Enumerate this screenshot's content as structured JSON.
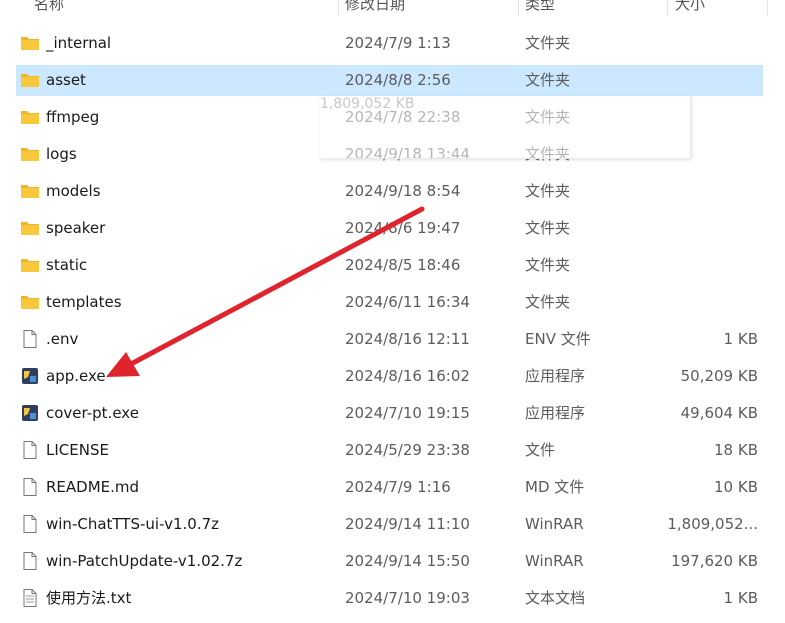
{
  "header": {
    "name": "名称",
    "date": "修改日期",
    "type": "类型",
    "size": "大小"
  },
  "ghost_tooltip": "1,809,052 KB",
  "files": [
    {
      "name": "_internal",
      "date": "2024/7/9 1:13",
      "type": "文件夹",
      "size": "",
      "icon": "folder-icon",
      "selected": false
    },
    {
      "name": "asset",
      "date": "2024/8/8 2:56",
      "type": "文件夹",
      "size": "",
      "icon": "folder-icon",
      "selected": true
    },
    {
      "name": "ffmpeg",
      "date": "2024/7/8 22:38",
      "type": "文件夹",
      "size": "",
      "icon": "folder-icon",
      "selected": false
    },
    {
      "name": "logs",
      "date": "2024/9/18 13:44",
      "type": "文件夹",
      "size": "",
      "icon": "folder-icon",
      "selected": false
    },
    {
      "name": "models",
      "date": "2024/9/18 8:54",
      "type": "文件夹",
      "size": "",
      "icon": "folder-icon",
      "selected": false
    },
    {
      "name": "speaker",
      "date": "2024/8/6 19:47",
      "type": "文件夹",
      "size": "",
      "icon": "folder-icon",
      "selected": false
    },
    {
      "name": "static",
      "date": "2024/8/5 18:46",
      "type": "文件夹",
      "size": "",
      "icon": "folder-icon",
      "selected": false
    },
    {
      "name": "templates",
      "date": "2024/6/11 16:34",
      "type": "文件夹",
      "size": "",
      "icon": "folder-icon",
      "selected": false
    },
    {
      "name": ".env",
      "date": "2024/8/16 12:11",
      "type": "ENV 文件",
      "size": "1 KB",
      "icon": "file-icon",
      "selected": false
    },
    {
      "name": "app.exe",
      "date": "2024/8/16 16:02",
      "type": "应用程序",
      "size": "50,209 KB",
      "icon": "exe-icon",
      "selected": false
    },
    {
      "name": "cover-pt.exe",
      "date": "2024/7/10 19:15",
      "type": "应用程序",
      "size": "49,604 KB",
      "icon": "exe-icon",
      "selected": false
    },
    {
      "name": "LICENSE",
      "date": "2024/5/29 23:38",
      "type": "文件",
      "size": "18 KB",
      "icon": "file-icon",
      "selected": false
    },
    {
      "name": "README.md",
      "date": "2024/7/9 1:16",
      "type": "MD 文件",
      "size": "10 KB",
      "icon": "file-icon",
      "selected": false
    },
    {
      "name": "win-ChatTTS-ui-v1.0.7z",
      "date": "2024/9/14 11:10",
      "type": "WinRAR",
      "size": "1,809,052...",
      "icon": "file-icon",
      "selected": false
    },
    {
      "name": "win-PatchUpdate-v1.02.7z",
      "date": "2024/9/14 15:50",
      "type": "WinRAR",
      "size": "197,620 KB",
      "icon": "file-icon",
      "selected": false
    },
    {
      "name": "使用方法.txt",
      "date": "2024/7/10 19:03",
      "type": "文本文档",
      "size": "1 KB",
      "icon": "text-file-icon",
      "selected": false
    }
  ],
  "colors": {
    "selection": "#cce8ff",
    "folder": "#f8c33c",
    "arrow": "#e0242d"
  }
}
